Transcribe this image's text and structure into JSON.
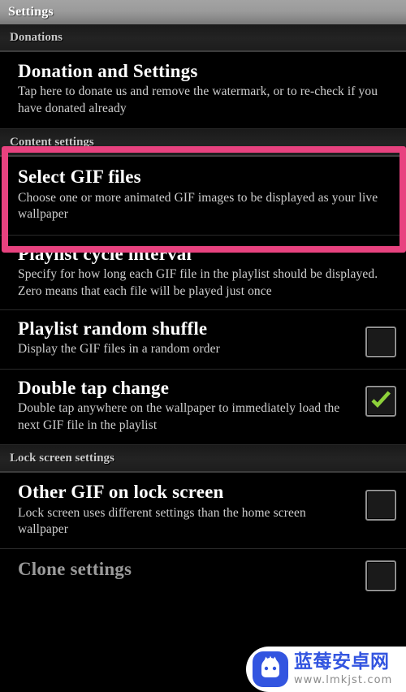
{
  "titlebar": {
    "title": "Settings"
  },
  "sections": [
    {
      "header": "Donations",
      "items": [
        {
          "title": "Donation and Settings",
          "summary": "Tap here to donate us and remove the watermark, or to re-check if you have donated already",
          "control": "none"
        }
      ]
    },
    {
      "header": "Content settings",
      "items": [
        {
          "title": "Select GIF files",
          "summary": "Choose one or more animated GIF images to be displayed as your live wallpaper",
          "control": "none"
        },
        {
          "title": "Playlist cycle interval",
          "summary": "Specify for how long each GIF file in the playlist should be displayed. Zero means that each file will be played just once",
          "control": "none"
        },
        {
          "title": "Playlist random shuffle",
          "summary": "Display the GIF files in a random order",
          "control": "checkbox",
          "checked": false
        },
        {
          "title": "Double tap change",
          "summary": "Double tap anywhere on the wallpaper to immediately load the next GIF file in the playlist",
          "control": "checkbox",
          "checked": true
        }
      ]
    },
    {
      "header": "Lock screen settings",
      "items": [
        {
          "title": "Other GIF on lock screen",
          "summary": "Lock screen uses different settings than the home screen wallpaper",
          "control": "checkbox",
          "checked": false
        },
        {
          "title": "Clone settings",
          "summary": "",
          "control": "checkbox",
          "checked": false,
          "dim": true
        }
      ]
    }
  ],
  "highlight": {
    "target": "Select GIF files",
    "color": "#e8427f",
    "border_width_px": 8
  },
  "watermark": {
    "brand_cn": "蓝莓安卓网",
    "url": "www.lmkjst.com",
    "logo_color": "#3355e0",
    "text_color": "#3355e0",
    "url_color": "#8a8a8a"
  },
  "colors": {
    "background": "#000000",
    "titlebar_top": "#a3a3a3",
    "titlebar_bottom": "#787878",
    "section_header_bg": "#1e1e1e",
    "section_header_text": "#c9c9c9",
    "pref_title": "#ffffff",
    "pref_summary": "#cfcfcf",
    "checkbox_border": "#8f8f8f",
    "check_green": "#8ed13a"
  }
}
